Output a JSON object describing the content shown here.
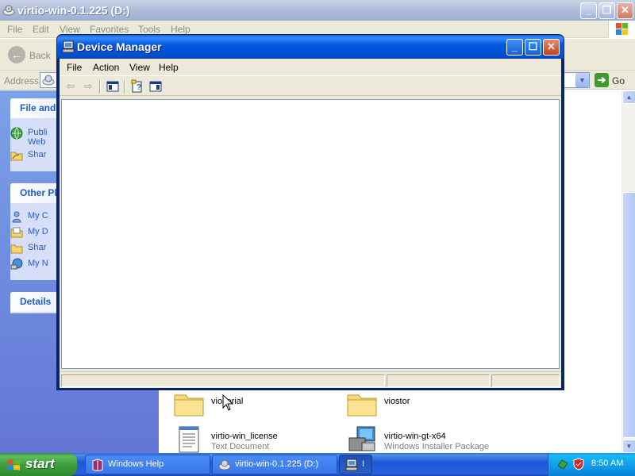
{
  "explorer": {
    "title": "virtio-win-0.1.225 (D:)",
    "menu": [
      "File",
      "Edit",
      "View",
      "Favorites",
      "Tools",
      "Help"
    ],
    "back_label": "Back",
    "address_label": "Address",
    "go_label": "Go",
    "left_pane": {
      "file_tasks": {
        "header": "File and",
        "items": [
          "Publi\nWeb",
          "Shar"
        ]
      },
      "other_places": {
        "header": "Other Pl",
        "items": [
          "My C",
          "My D",
          "Shar",
          "My N"
        ]
      },
      "details": {
        "header": "Details"
      }
    },
    "files": [
      {
        "name": "vioserial",
        "type": ""
      },
      {
        "name": "viostor",
        "type": ""
      },
      {
        "name": "virtio-win_license",
        "type": "Text Document"
      },
      {
        "name": "virtio-win-gt-x64",
        "type": "Windows Installer Package"
      }
    ]
  },
  "device_manager": {
    "title": "Device Manager",
    "menu": [
      "File",
      "Action",
      "View",
      "Help"
    ],
    "toolbar_icons": [
      "back-arrow-icon",
      "forward-arrow-icon",
      "show-hide-console-tree-icon",
      "properties-help-icon",
      "show-hide-action-pane-icon"
    ]
  },
  "taskbar": {
    "start_label": "start",
    "tasks": [
      {
        "label": "Windows Help",
        "icon": "help-book-icon",
        "active": false
      },
      {
        "label": "virtio-win-0.1.225 (D:)",
        "icon": "cd-drive-icon",
        "active": false
      },
      {
        "label": "I",
        "icon": "device-manager-icon",
        "active": true
      }
    ],
    "clock": "8:50 AM"
  },
  "colors": {
    "xp_blue_title": "#0458dc",
    "taskbar_blue": "#2157d7",
    "start_green": "#3f9f3f",
    "tray_blue": "#109ae9",
    "task_link_blue": "#215dc6"
  }
}
